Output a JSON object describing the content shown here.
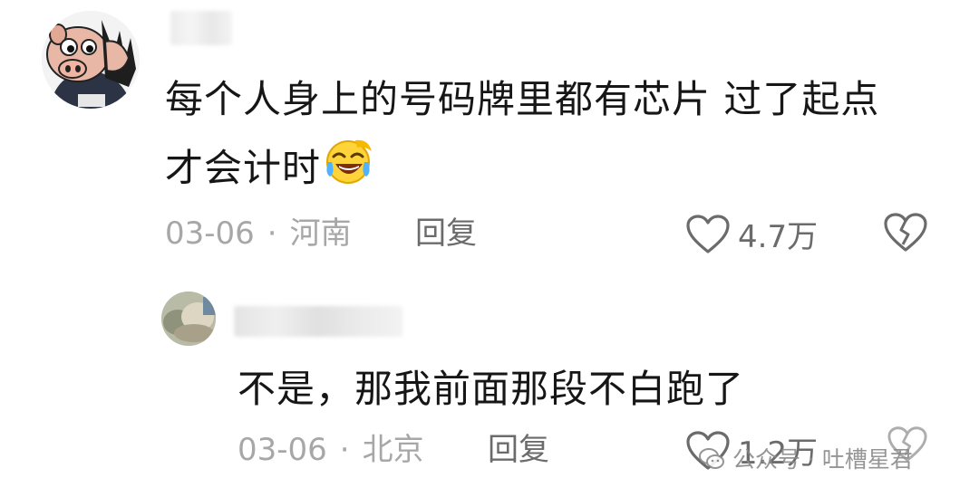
{
  "comments": [
    {
      "avatar_icon": "pig-cartoon-avatar-icon",
      "text_line1": "每个人身上的号码牌里都有芯片 过了起点",
      "text_line2": "才会计时",
      "emoji": "laughing-crying-emoji-icon",
      "date": "03-06",
      "location": "河南",
      "reply_label": "回复",
      "likes": "4.7万"
    },
    {
      "avatar_icon": "photo-avatar-icon",
      "text": "不是，那我前面那段不白跑了",
      "date": "03-06",
      "location": "北京",
      "reply_label": "回复",
      "likes": "1.2万"
    }
  ],
  "separator": "·",
  "watermark": {
    "icon": "wechat-official-account-icon",
    "text": "公众号 · 吐槽星君"
  }
}
